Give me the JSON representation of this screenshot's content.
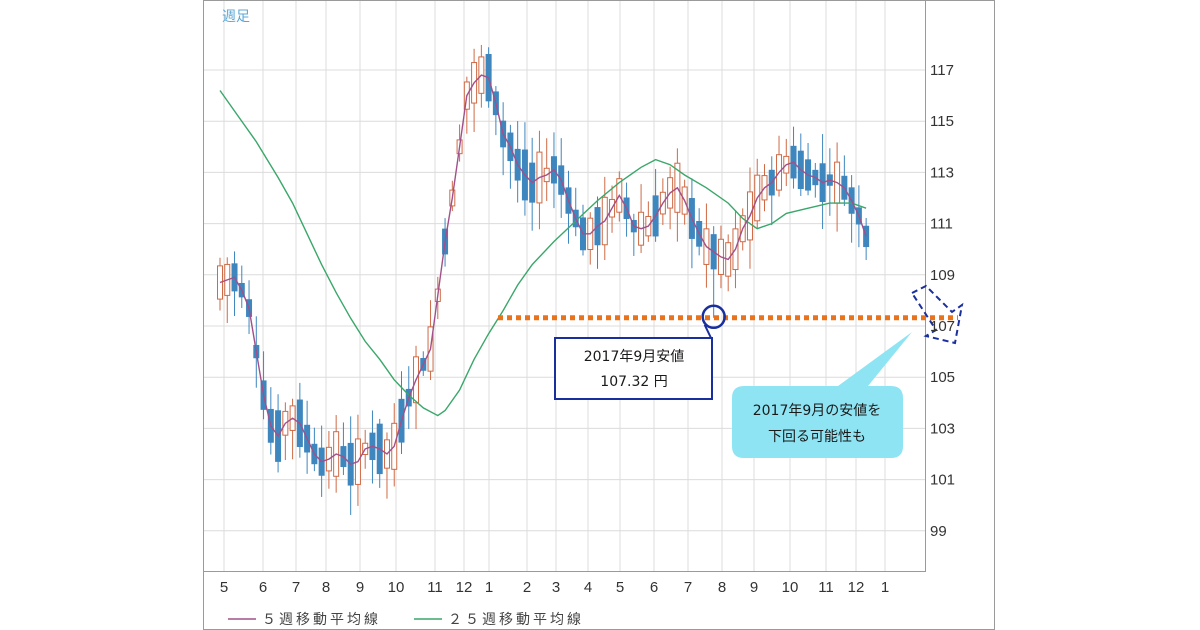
{
  "chart_data": {
    "type": "candlestick",
    "period_label": "週足",
    "y_ticks": [
      99,
      101,
      103,
      105,
      107,
      109,
      111,
      113,
      115,
      117
    ],
    "ylim": [
      97.5,
      119.5
    ],
    "x_tick_labels": [
      "5",
      "6",
      "7",
      "8",
      "9",
      "10",
      "11",
      "12",
      "1",
      "2",
      "3",
      "4",
      "5",
      "6",
      "7",
      "8",
      "9",
      "10",
      "11",
      "12",
      "1"
    ],
    "grid": true,
    "colors": {
      "up": "#cf6a45",
      "down": "#3e86be",
      "ma5": "#a0508a",
      "ma25": "#3aa76a",
      "support": "#e8731c",
      "marker": "#1a2f9e",
      "callout_fill": "#8ee4f3"
    },
    "ma5_points": [
      [
        0,
        108.7
      ],
      [
        1,
        108.8
      ],
      [
        2,
        108.9
      ],
      [
        3,
        108.4
      ],
      [
        4,
        107.7
      ],
      [
        5,
        106.0
      ],
      [
        6,
        104.3
      ],
      [
        7,
        103.1
      ],
      [
        8,
        102.7
      ],
      [
        9,
        103.2
      ],
      [
        10,
        103.4
      ],
      [
        11,
        103.2
      ],
      [
        12,
        102.6
      ],
      [
        13,
        102.0
      ],
      [
        14,
        101.7
      ],
      [
        15,
        101.8
      ],
      [
        16,
        102.0
      ],
      [
        17,
        101.9
      ],
      [
        18,
        101.6
      ],
      [
        19,
        101.7
      ],
      [
        20,
        102.2
      ],
      [
        21,
        102.3
      ],
      [
        22,
        102.2
      ],
      [
        23,
        102.0
      ],
      [
        24,
        102.3
      ],
      [
        25,
        103.3
      ],
      [
        26,
        104.2
      ],
      [
        27,
        104.9
      ],
      [
        28,
        105.5
      ],
      [
        29,
        106.1
      ],
      [
        30,
        108.2
      ],
      [
        31,
        110.3
      ],
      [
        32,
        112.0
      ],
      [
        33,
        114.0
      ],
      [
        34,
        116.0
      ],
      [
        35,
        116.5
      ],
      [
        36,
        116.8
      ],
      [
        37,
        116.7
      ],
      [
        38,
        115.7
      ],
      [
        39,
        114.5
      ],
      [
        40,
        114.0
      ],
      [
        41,
        113.3
      ],
      [
        42,
        112.9
      ],
      [
        43,
        112.6
      ],
      [
        44,
        112.8
      ],
      [
        45,
        112.9
      ],
      [
        46,
        113.1
      ],
      [
        47,
        112.7
      ],
      [
        48,
        111.9
      ],
      [
        49,
        111.2
      ],
      [
        50,
        110.6
      ],
      [
        51,
        110.6
      ],
      [
        52,
        110.9
      ],
      [
        53,
        111.1
      ],
      [
        54,
        111.6
      ],
      [
        55,
        112.1
      ],
      [
        56,
        111.6
      ],
      [
        57,
        110.9
      ],
      [
        58,
        110.8
      ],
      [
        59,
        110.9
      ],
      [
        60,
        111.3
      ],
      [
        61,
        111.8
      ],
      [
        62,
        112.2
      ],
      [
        63,
        112.4
      ],
      [
        64,
        111.9
      ],
      [
        65,
        111.2
      ],
      [
        66,
        110.6
      ],
      [
        67,
        110.1
      ],
      [
        68,
        109.9
      ],
      [
        69,
        109.7
      ],
      [
        70,
        109.6
      ],
      [
        71,
        110.0
      ],
      [
        72,
        110.8
      ],
      [
        73,
        111.3
      ],
      [
        74,
        112.0
      ],
      [
        75,
        112.4
      ],
      [
        76,
        112.6
      ],
      [
        77,
        113.0
      ],
      [
        78,
        113.3
      ],
      [
        79,
        113.4
      ],
      [
        80,
        113.1
      ],
      [
        81,
        112.9
      ],
      [
        82,
        112.8
      ],
      [
        83,
        112.6
      ],
      [
        84,
        112.7
      ],
      [
        85,
        112.6
      ],
      [
        86,
        112.4
      ],
      [
        87,
        111.9
      ],
      [
        88,
        111.3
      ],
      [
        89,
        110.5
      ]
    ],
    "ma25_points": [
      [
        0,
        116.2
      ],
      [
        2,
        115.4
      ],
      [
        5,
        114.2
      ],
      [
        8,
        112.8
      ],
      [
        10,
        111.8
      ],
      [
        12,
        110.6
      ],
      [
        14,
        109.4
      ],
      [
        16,
        108.3
      ],
      [
        18,
        107.3
      ],
      [
        20,
        106.4
      ],
      [
        22,
        105.7
      ],
      [
        24,
        104.9
      ],
      [
        26,
        104.3
      ],
      [
        28,
        103.8
      ],
      [
        30,
        103.5
      ],
      [
        31,
        103.7
      ],
      [
        33,
        104.5
      ],
      [
        35,
        105.7
      ],
      [
        37,
        106.7
      ],
      [
        39,
        107.6
      ],
      [
        41,
        108.6
      ],
      [
        43,
        109.4
      ],
      [
        46,
        110.3
      ],
      [
        49,
        111.1
      ],
      [
        52,
        111.9
      ],
      [
        55,
        112.6
      ],
      [
        58,
        113.2
      ],
      [
        60,
        113.5
      ],
      [
        62,
        113.3
      ],
      [
        64,
        112.9
      ],
      [
        67,
        112.4
      ],
      [
        70,
        111.8
      ],
      [
        72,
        111.2
      ],
      [
        74,
        110.8
      ],
      [
        76,
        111.0
      ],
      [
        78,
        111.4
      ],
      [
        81,
        111.6
      ],
      [
        84,
        111.8
      ],
      [
        87,
        111.8
      ],
      [
        89,
        111.6
      ]
    ],
    "support_level": 107.32,
    "low_marker_week": 68,
    "annotation_low": {
      "line1": "2017年9月安値",
      "line2": "107.32 円"
    },
    "annotation_callout": {
      "line1": "2017年9月の安値を",
      "line2": "下回る可能性も"
    },
    "legend": [
      {
        "name": "５週移動平均線",
        "color": "#a0508a"
      },
      {
        "name": "２５週移動平均線",
        "color": "#3aa76a"
      }
    ]
  }
}
